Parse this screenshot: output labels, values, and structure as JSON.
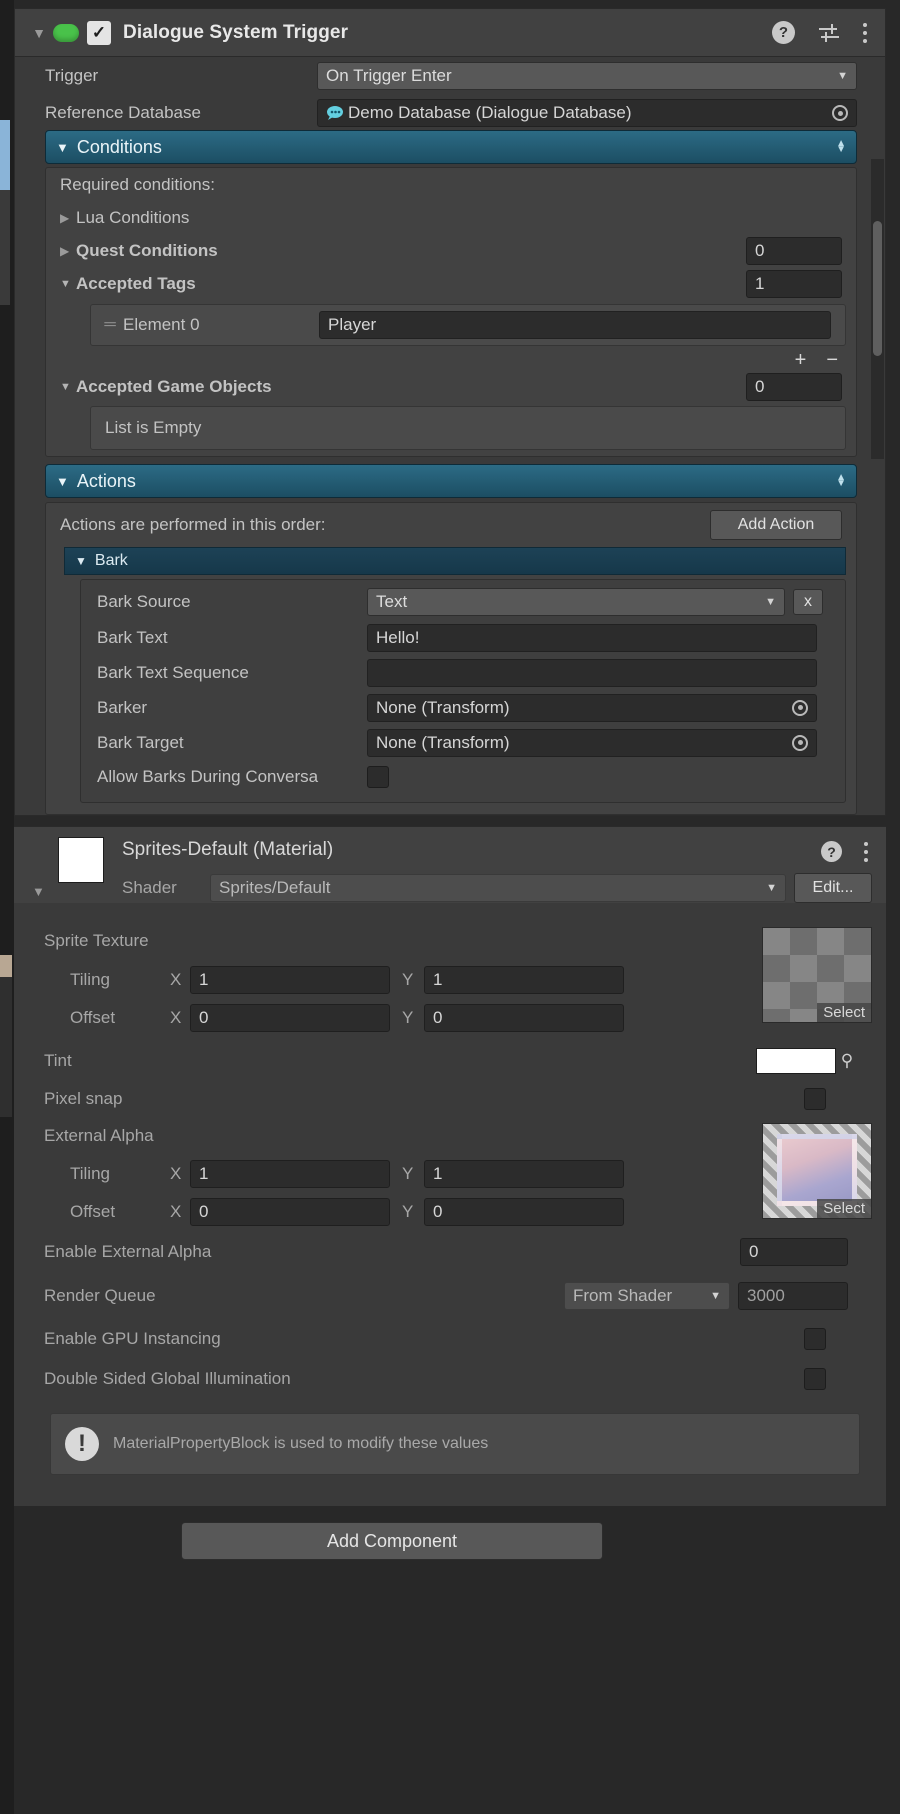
{
  "component": {
    "title": "Dialogue System Trigger",
    "enabled_checkmark": "✓",
    "help_icon": "?",
    "preset_icon": "sliders-icon",
    "menu_icon": "⋮"
  },
  "fields": {
    "trigger_label": "Trigger",
    "trigger_value": "On Trigger Enter",
    "reference_database_label": "Reference Database",
    "reference_database_value": "Demo Database (Dialogue Database)"
  },
  "conditions": {
    "header": "Conditions",
    "required_label": "Required conditions:",
    "lua_conditions": "Lua Conditions",
    "quest_conditions": "Quest Conditions",
    "quest_conditions_count": "0",
    "accepted_tags": "Accepted Tags",
    "accepted_tags_count": "1",
    "element_label": "Element 0",
    "element_value": "Player",
    "add_button": "+",
    "remove_button": "−",
    "accepted_game_objects": "Accepted Game Objects",
    "accepted_game_objects_count": "0",
    "list_empty": "List is Empty"
  },
  "actions": {
    "header": "Actions",
    "order_note": "Actions are performed in this order:",
    "add_action_button": "Add Action",
    "bark": {
      "header": "Bark",
      "remove_button": "x",
      "source_label": "Bark Source",
      "source_value": "Text",
      "text_label": "Bark Text",
      "text_value": "Hello!",
      "sequence_label": "Bark Text Sequence",
      "sequence_value": "",
      "barker_label": "Barker",
      "barker_value": "None (Transform)",
      "target_label": "Bark Target",
      "target_value": "None (Transform)",
      "allow_label": "Allow Barks During Conversa"
    }
  },
  "material": {
    "title": "Sprites-Default (Material)",
    "help_icon": "?",
    "menu_icon": "⋮",
    "shader_label": "Shader",
    "shader_value": "Sprites/Default",
    "edit_button": "Edit...",
    "sprite_texture_label": "Sprite Texture",
    "sprite_select_label": "Select",
    "tiling_label": "Tiling",
    "offset_label": "Offset",
    "axis_x": "X",
    "axis_y": "Y",
    "sprite_tiling_x": "1",
    "sprite_tiling_y": "1",
    "sprite_offset_x": "0",
    "sprite_offset_y": "0",
    "tint_label": "Tint",
    "tint_color": "#ffffff",
    "eyedropper_icon": "eyedropper-icon",
    "pixel_snap_label": "Pixel snap",
    "external_alpha_label": "External Alpha",
    "alpha_select_label": "Select",
    "alpha_tiling_x": "1",
    "alpha_tiling_y": "1",
    "alpha_offset_x": "0",
    "alpha_offset_y": "0",
    "enable_external_alpha_label": "Enable External Alpha",
    "enable_external_alpha_value": "0",
    "render_queue_label": "Render Queue",
    "render_queue_mode": "From Shader",
    "render_queue_value": "3000",
    "gpu_instancing_label": "Enable GPU Instancing",
    "double_sided_label": "Double Sided Global Illumination",
    "info_text": "MaterialPropertyBlock is used to modify these values",
    "info_icon": "!"
  },
  "footer": {
    "add_component": "Add Component"
  }
}
